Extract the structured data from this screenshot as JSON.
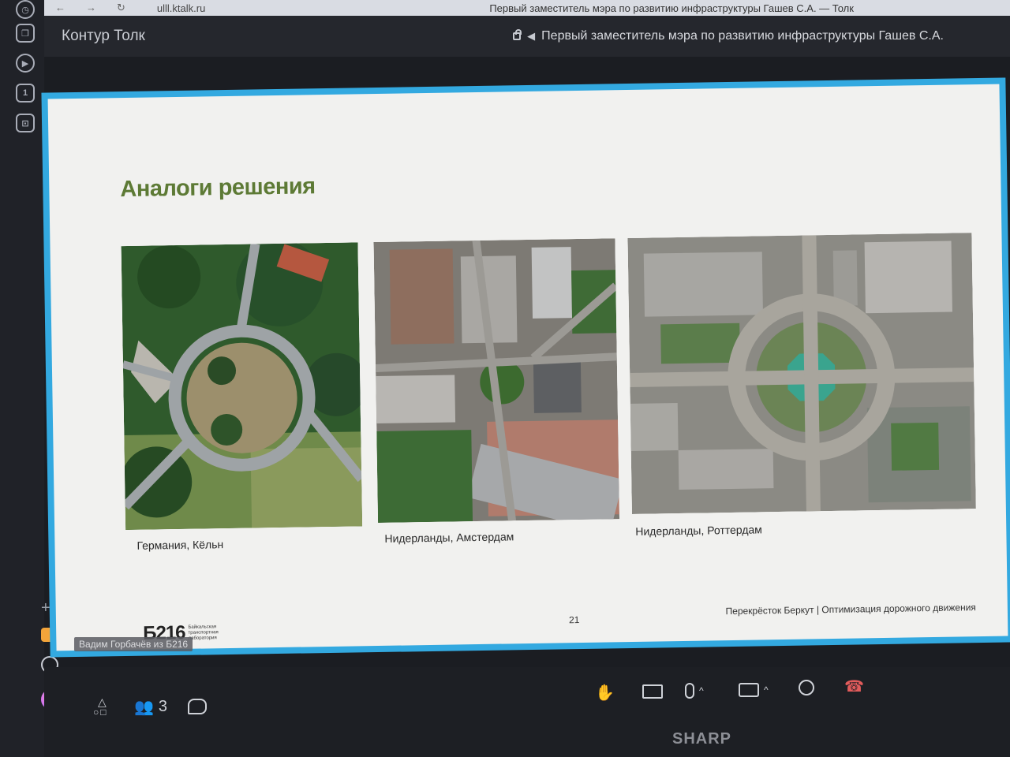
{
  "browser": {
    "url": "ulll.ktalk.ru",
    "tab_title": "Первый заместитель мэра по развитию инфраструктуры Гашев С.А. — Толк"
  },
  "app": {
    "name": "Контур Толк",
    "meeting_title": "Первый заместитель мэра по развитию инфраструктуры Гашев С.А."
  },
  "rail": {
    "icons": [
      "history-icon",
      "copy-icon",
      "play-icon",
      "calendar-icon",
      "screenshot-icon",
      "add-icon",
      "mail-icon",
      "camera-icon",
      "alice-icon",
      "more-icon"
    ],
    "calendar_day": "1"
  },
  "slide": {
    "title": "Аналоги решения",
    "photos": [
      {
        "caption": "Германия, Кёльн"
      },
      {
        "caption": "Нидерланды, Амстердам"
      },
      {
        "caption": "Нидерланды, Роттердам"
      }
    ],
    "page_number": "21",
    "footer_right": "Перекрёсток Беркут | Оптимизация дорожного движения",
    "logo_mark": "Б216",
    "logo_sub": "Байкальская транспортная лаборатория"
  },
  "speaker": "Вадим Горбачёв из Б216",
  "toolbar": {
    "participants_count": "3",
    "icons": [
      "shapes-icon",
      "participants-icon",
      "chat-icon",
      "raise-hand-icon",
      "screen-share-icon",
      "microphone-icon",
      "camera-icon",
      "circle-icon",
      "hang-up-icon"
    ]
  },
  "monitor_brand": "SHARP",
  "colors": {
    "share_border": "#33a9e0",
    "title_green": "#5d7a35",
    "hangup_red": "#e25b5b"
  }
}
